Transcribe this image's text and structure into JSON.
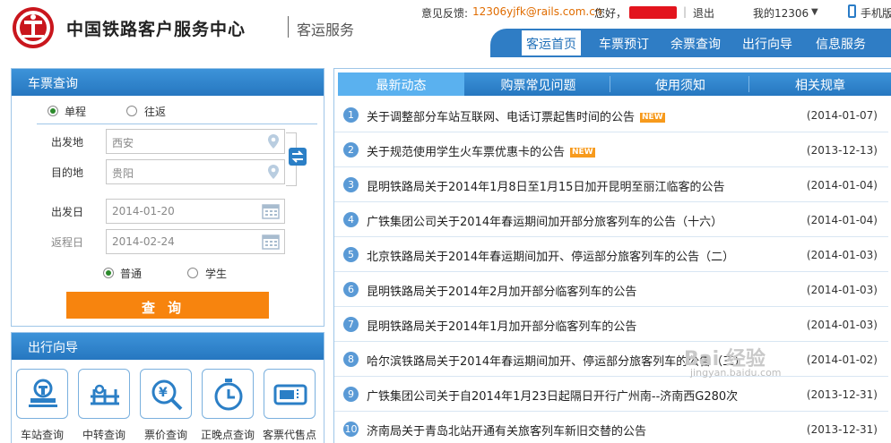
{
  "header": {
    "site_name": "中国铁路客户服务中心",
    "site_sub": "客运服务",
    "feedback_label": "意见反馈:",
    "feedback_email": "12306yjfk@rails.com.cn",
    "greeting": "您好，",
    "separator": "|",
    "logout": "退出",
    "my12306": "我的12306",
    "mobile": "手机版",
    "brand_color": "#c9161d",
    "accent_color": "#2f7dc5"
  },
  "nav": {
    "items": [
      {
        "label": "客运首页",
        "active": true
      },
      {
        "label": "车票预订"
      },
      {
        "label": "余票查询"
      },
      {
        "label": "出行向导"
      },
      {
        "label": "信息服务"
      }
    ]
  },
  "search": {
    "title": "车票查询",
    "trip_types": [
      "单程",
      "往返"
    ],
    "trip_selected": "单程",
    "from_label": "出发地",
    "from_value": "西安",
    "to_label": "目的地",
    "to_value": "贵阳",
    "depart_label": "出发日",
    "depart_value": "2014-01-20",
    "return_label": "返程日",
    "return_value": "2014-02-24",
    "ticket_types": [
      "普通",
      "学生"
    ],
    "ticket_selected": "普通",
    "query_button": "查询",
    "button_color": "#f7840e"
  },
  "guide": {
    "title": "出行向导",
    "items": [
      {
        "label": "车站查询",
        "icon": "station-icon"
      },
      {
        "label": "中转查询",
        "icon": "transfer-icon"
      },
      {
        "label": "票价查询",
        "icon": "price-search-icon"
      },
      {
        "label": "正晚点查询",
        "icon": "clock-icon"
      },
      {
        "label": "客票代售点",
        "icon": "ticket-agency-icon"
      }
    ]
  },
  "news": {
    "tabs": [
      "最新动态",
      "购票常见问题",
      "使用须知",
      "相关规章"
    ],
    "active_tab": "最新动态",
    "new_badge": "NEW",
    "items": [
      {
        "num": "1",
        "title": "关于调整部分车站互联网、电话订票起售时间的公告",
        "date": "(2014-01-07)",
        "is_new": true
      },
      {
        "num": "2",
        "title": "关于规范使用学生火车票优惠卡的公告",
        "date": "(2013-12-13)",
        "is_new": true
      },
      {
        "num": "3",
        "title": "昆明铁路局关于2014年1月8日至1月15日加开昆明至丽江临客的公告",
        "date": "(2014-01-04)"
      },
      {
        "num": "4",
        "title": "广铁集团公司关于2014年春运期间加开部分旅客列车的公告（十六）",
        "date": "(2014-01-04)"
      },
      {
        "num": "5",
        "title": "北京铁路局关于2014年春运期间加开、停运部分旅客列车的公告（二）",
        "date": "(2014-01-03)"
      },
      {
        "num": "6",
        "title": "昆明铁路局关于2014年2月加开部分临客列车的公告",
        "date": "(2014-01-03)"
      },
      {
        "num": "7",
        "title": "昆明铁路局关于2014年1月加开部分临客列车的公告",
        "date": "(2014-01-03)"
      },
      {
        "num": "8",
        "title": "哈尔滨铁路局关于2014年春运期间加开、停运部分旅客列车的公告（三）",
        "date": "(2014-01-02)"
      },
      {
        "num": "9",
        "title": "广铁集团公司关于自2014年1月23日起隔日开行广州南--济南西G280次",
        "date": "(2013-12-31)"
      },
      {
        "num": "10",
        "title": "济南局关于青岛北站开通有关旅客列车新旧交替的公告",
        "date": "(2013-12-31)"
      }
    ]
  },
  "watermark": {
    "text": "Bai 经验",
    "url": "jingyan.baidu.com"
  }
}
